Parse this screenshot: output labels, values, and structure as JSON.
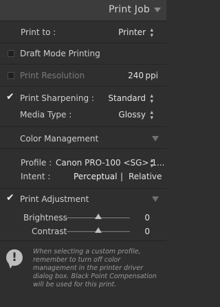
{
  "header": {
    "title": "Print Job"
  },
  "print_to": {
    "label": "Print to :",
    "value": "Printer"
  },
  "draft_mode": {
    "label": "Draft Mode Printing",
    "checked": false
  },
  "print_resolution": {
    "label": "Print Resolution",
    "value": "240",
    "unit": "ppi",
    "checked": false
  },
  "sharpening": {
    "label": "Print Sharpening :",
    "value": "Standard",
    "checked": true,
    "media_label": "Media Type :",
    "media_value": "Glossy"
  },
  "color_management": {
    "title": "Color Management",
    "profile_label": "Profile :",
    "profile_value": "Canon PRO-100 <SG> 1...",
    "intent_label": "Intent :",
    "intent_options": [
      "Perceptual",
      "Relative"
    ],
    "intent_selected": "Perceptual"
  },
  "print_adjustment": {
    "label": "Print Adjustment",
    "checked": true,
    "brightness": {
      "label": "Brightness",
      "value": "0",
      "level": 0.5
    },
    "contrast": {
      "label": "Contrast",
      "value": "0",
      "level": 0.5
    }
  },
  "info": {
    "text": "When selecting a custom profile, remember to turn off color management in the printer driver dialog box. Black Point Compensation will be used for this print."
  },
  "colors": {
    "background": "#2f2f2f",
    "header": "#3c3c3c",
    "text": "#cfcfcf",
    "dim": "#7a7a7a"
  }
}
